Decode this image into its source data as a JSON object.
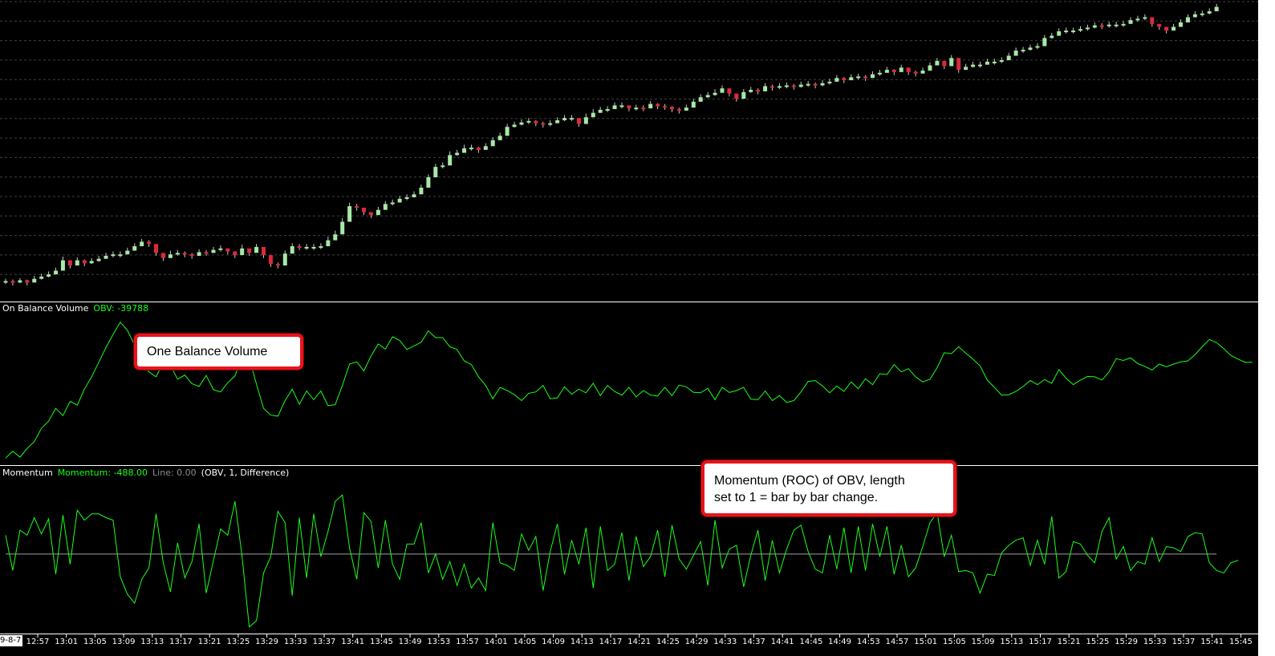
{
  "price_pane": {
    "colors": {
      "up": "#a8e8a6",
      "down": "#e0283a",
      "wick": "#c8c8c8",
      "grid": "#404040",
      "background": "#000000"
    }
  },
  "obv_pane": {
    "title": "On Balance Volume",
    "readout": "OBV: -39788",
    "line_color": "#19ff19"
  },
  "momentum_pane": {
    "title": "Momentum",
    "readout": "Momentum: -488.00",
    "zero_readout": "Line: 0.00",
    "params": "(OBV, 1, Difference)",
    "line_color": "#19ff19",
    "zero_line_color": "#a0a0a0"
  },
  "annotations": {
    "obv_callout": "One Balance Volume",
    "momentum_callout_line1": "Momentum (ROC) of OBV, length",
    "momentum_callout_line2": "set to 1 = bar by bar change."
  },
  "x_axis": {
    "date_label": "9-8-7",
    "ticks": [
      "12:57",
      "13:01",
      "13:05",
      "13:09",
      "13:13",
      "13:17",
      "13:21",
      "13:25",
      "13:29",
      "13:33",
      "13:37",
      "13:41",
      "13:45",
      "13:49",
      "13:53",
      "13:57",
      "14:01",
      "14:05",
      "14:09",
      "14:13",
      "14:17",
      "14:21",
      "14:25",
      "14:29",
      "14:33",
      "14:37",
      "14:41",
      "14:45",
      "14:49",
      "14:53",
      "14:57",
      "15:01",
      "15:05",
      "15:09",
      "15:13",
      "15:17",
      "15:21",
      "15:25",
      "15:29",
      "15:33",
      "15:37",
      "15:41",
      "15:45"
    ]
  },
  "chart_data": [
    {
      "type": "candlestick",
      "pane": "price",
      "title": "",
      "x": [
        "12:53",
        "12:54",
        "12:55",
        "12:56",
        "12:57",
        "12:58",
        "12:59",
        "13:00",
        "13:01",
        "13:02",
        "13:03",
        "13:04",
        "13:05",
        "13:06",
        "13:07",
        "13:08",
        "13:09",
        "13:10",
        "13:11",
        "13:12",
        "13:13",
        "13:14",
        "13:15",
        "13:16",
        "13:17",
        "13:18",
        "13:19",
        "13:20",
        "13:21",
        "13:22",
        "13:23",
        "13:24",
        "13:25",
        "13:26",
        "13:27",
        "13:28",
        "13:29",
        "13:30",
        "13:31",
        "13:32",
        "13:33",
        "13:34",
        "13:35",
        "13:36",
        "13:37",
        "13:38",
        "13:39",
        "13:40",
        "13:41",
        "13:42",
        "13:43",
        "13:44",
        "13:45",
        "13:46",
        "13:47",
        "13:48",
        "13:49",
        "13:50",
        "13:51",
        "13:52",
        "13:53",
        "13:54",
        "13:55",
        "13:56",
        "13:57",
        "13:58",
        "13:59",
        "14:00",
        "14:01",
        "14:02",
        "14:03",
        "14:04",
        "14:05",
        "14:06",
        "14:07",
        "14:08",
        "14:09",
        "14:10",
        "14:11",
        "14:12",
        "14:13",
        "14:14",
        "14:15",
        "14:16",
        "14:17",
        "14:18",
        "14:19",
        "14:20",
        "14:21",
        "14:22",
        "14:23",
        "14:24",
        "14:25",
        "14:26",
        "14:27",
        "14:28",
        "14:29",
        "14:30",
        "14:31",
        "14:32",
        "14:33",
        "14:34",
        "14:35",
        "14:36",
        "14:37",
        "14:38",
        "14:39",
        "14:40",
        "14:41",
        "14:42",
        "14:43",
        "14:44",
        "14:45",
        "14:46",
        "14:47",
        "14:48",
        "14:49",
        "14:50",
        "14:51",
        "14:52",
        "14:53",
        "14:54",
        "14:55",
        "14:56",
        "14:57",
        "14:58",
        "14:59",
        "15:00",
        "15:01",
        "15:02",
        "15:03",
        "15:04",
        "15:05",
        "15:06",
        "15:07",
        "15:08",
        "15:09",
        "15:10",
        "15:11",
        "15:12",
        "15:13",
        "15:14",
        "15:15",
        "15:16",
        "15:17",
        "15:18",
        "15:19",
        "15:20",
        "15:21",
        "15:22",
        "15:23",
        "15:24",
        "15:25",
        "15:26",
        "15:27",
        "15:28",
        "15:29",
        "15:30",
        "15:31",
        "15:32",
        "15:33",
        "15:34",
        "15:35",
        "15:36",
        "15:37",
        "15:38",
        "15:39",
        "15:40",
        "15:41"
      ],
      "close": [
        14,
        12,
        15,
        12,
        17,
        20,
        23,
        28,
        42,
        35,
        42,
        38,
        41,
        44,
        48,
        50,
        50,
        55,
        61,
        67,
        64,
        52,
        45,
        50,
        52,
        50,
        48,
        53,
        52,
        56,
        58,
        54,
        49,
        58,
        52,
        60,
        49,
        37,
        35,
        51,
        61,
        60,
        60,
        60,
        61,
        69,
        77,
        94,
        115,
        113,
        107,
        103,
        110,
        118,
        120,
        125,
        127,
        131,
        140,
        154,
        168,
        170,
        184,
        187,
        193,
        194,
        191,
        196,
        204,
        210,
        222,
        225,
        228,
        230,
        227,
        225,
        227,
        231,
        234,
        234,
        226,
        235,
        241,
        245,
        246,
        251,
        251,
        247,
        248,
        247,
        253,
        250,
        249,
        246,
        244,
        248,
        256,
        262,
        265,
        268,
        274,
        267,
        260,
        269,
        272,
        270,
        277,
        275,
        277,
        278,
        276,
        279,
        280,
        278,
        281,
        283,
        288,
        285,
        289,
        290,
        288,
        293,
        295,
        299,
        296,
        302,
        296,
        294,
        298,
        305,
        311,
        304,
        315,
        299,
        303,
        306,
        306,
        310,
        310,
        312,
        318,
        325,
        326,
        329,
        331,
        342,
        345,
        351,
        352,
        352,
        354,
        356,
        359,
        358,
        360,
        360,
        361,
        366,
        368,
        370,
        361,
        357,
        352,
        357,
        363,
        370,
        374,
        375,
        378,
        384
      ],
      "high": [
        17,
        16,
        18,
        16,
        21,
        24,
        27,
        32,
        47,
        40,
        46,
        43,
        45,
        48,
        52,
        54,
        54,
        59,
        65,
        71,
        69,
        56,
        50,
        55,
        56,
        54,
        52,
        57,
        56,
        60,
        62,
        58,
        53,
        63,
        57,
        64,
        54,
        41,
        39,
        55,
        65,
        64,
        64,
        64,
        65,
        74,
        82,
        99,
        120,
        118,
        111,
        107,
        114,
        122,
        124,
        129,
        131,
        135,
        144,
        158,
        172,
        174,
        189,
        191,
        198,
        198,
        195,
        200,
        208,
        214,
        226,
        229,
        232,
        234,
        231,
        229,
        231,
        235,
        238,
        238,
        230,
        240,
        246,
        249,
        250,
        255,
        255,
        251,
        252,
        251,
        257,
        254,
        253,
        250,
        248,
        252,
        260,
        266,
        269,
        273,
        278,
        271,
        264,
        273,
        276,
        274,
        281,
        279,
        281,
        282,
        280,
        283,
        284,
        282,
        285,
        287,
        292,
        289,
        293,
        294,
        292,
        297,
        299,
        303,
        300,
        306,
        300,
        298,
        302,
        309,
        315,
        308,
        319,
        303,
        307,
        310,
        310,
        314,
        314,
        316,
        322,
        329,
        330,
        333,
        335,
        346,
        349,
        355,
        356,
        356,
        358,
        360,
        363,
        362,
        364,
        364,
        365,
        370,
        372,
        374,
        365,
        361,
        356,
        361,
        367,
        374,
        378,
        379,
        382,
        388
      ],
      "low": [
        10,
        8,
        11,
        8,
        13,
        16,
        19,
        24,
        38,
        31,
        38,
        34,
        37,
        40,
        44,
        46,
        46,
        51,
        57,
        63,
        60,
        48,
        41,
        46,
        48,
        46,
        44,
        49,
        48,
        52,
        54,
        50,
        45,
        54,
        48,
        56,
        45,
        33,
        31,
        47,
        57,
        56,
        56,
        56,
        57,
        65,
        73,
        90,
        111,
        109,
        103,
        99,
        106,
        114,
        116,
        121,
        123,
        127,
        136,
        150,
        164,
        166,
        180,
        183,
        189,
        190,
        187,
        192,
        200,
        206,
        218,
        221,
        224,
        226,
        223,
        221,
        223,
        227,
        230,
        230,
        222,
        231,
        237,
        241,
        242,
        247,
        247,
        243,
        244,
        243,
        249,
        246,
        245,
        242,
        240,
        244,
        252,
        258,
        261,
        264,
        270,
        263,
        256,
        265,
        268,
        266,
        273,
        271,
        273,
        274,
        272,
        275,
        276,
        274,
        277,
        279,
        284,
        281,
        285,
        286,
        284,
        289,
        291,
        295,
        292,
        298,
        292,
        290,
        294,
        301,
        307,
        300,
        311,
        295,
        299,
        302,
        302,
        306,
        306,
        308,
        314,
        321,
        322,
        325,
        327,
        338,
        341,
        347,
        348,
        348,
        350,
        352,
        355,
        354,
        356,
        356,
        357,
        362,
        364,
        366,
        357,
        353,
        348,
        353,
        359,
        366,
        370,
        371,
        374,
        380
      ]
    },
    {
      "type": "line",
      "pane": "obv",
      "title": "On Balance Volume",
      "series": [
        {
          "name": "OBV",
          "values": [
            -39788
          ]
        }
      ],
      "values": [
        -60800,
        -59300,
        -60600,
        -58700,
        -57200,
        -54300,
        -52700,
        -49900,
        -51500,
        -48400,
        -49200,
        -45700,
        -43000,
        -39800,
        -36600,
        -33700,
        -31000,
        -32800,
        -36000,
        -39900,
        -41900,
        -43000,
        -39800,
        -40500,
        -43500,
        -42600,
        -44500,
        -45100,
        -42700,
        -45800,
        -46300,
        -44300,
        -42800,
        -38600,
        -38800,
        -44600,
        -49900,
        -51400,
        -51600,
        -48200,
        -45700,
        -49000,
        -46100,
        -48000,
        -46100,
        -49300,
        -49100,
        -44900,
        -40200,
        -39700,
        -41700,
        -38400,
        -35800,
        -36900,
        -34200,
        -35000,
        -37000,
        -36200,
        -35400,
        -32900,
        -34400,
        -34400,
        -36400,
        -37000,
        -39500,
        -40300,
        -43000,
        -44900,
        -47800,
        -45300,
        -46000,
        -46900,
        -48200,
        -46600,
        -46300,
        -44900,
        -47800,
        -47600,
        -45200,
        -46800,
        -45700,
        -46500,
        -44400,
        -47100,
        -44900,
        -46200,
        -47000,
        -45300,
        -47400,
        -46000,
        -47000,
        -47200,
        -45300,
        -47100,
        -44800,
        -45200,
        -46400,
        -46500,
        -45500,
        -48000,
        -45300,
        -46400,
        -46000,
        -45300,
        -47900,
        -48000,
        -46100,
        -48200,
        -47100,
        -48600,
        -48200,
        -46300,
        -44000,
        -43800,
        -45000,
        -46500,
        -45000,
        -46200,
        -44100,
        -45600,
        -43400,
        -44700,
        -42300,
        -42500,
        -40300,
        -41900,
        -41200,
        -43000,
        -44100,
        -43500,
        -41000,
        -37700,
        -37900,
        -36400,
        -37800,
        -39100,
        -40600,
        -43700,
        -45300,
        -47000,
        -46900,
        -46200,
        -45100,
        -43800,
        -44700,
        -43600,
        -44400,
        -41400,
        -43300,
        -44700,
        -43700,
        -42900,
        -43000,
        -43700,
        -41900,
        -39000,
        -39400,
        -38800,
        -40100,
        -40700,
        -41500,
        -40200,
        -40800,
        -40200,
        -39700,
        -39500,
        -38100,
        -36400,
        -34800,
        -35500,
        -36800,
        -38300,
        -39100,
        -39800,
        -39788
      ],
      "ylim": [
        -62000,
        -30000
      ]
    },
    {
      "type": "line",
      "pane": "momentum",
      "title": "Momentum",
      "series": [
        {
          "name": "Momentum",
          "values": [
            -488.0
          ]
        },
        {
          "name": "Line",
          "values": [
            0.0
          ]
        }
      ],
      "values": [
        1500,
        -1300,
        1900,
        1500,
        2900,
        1600,
        2800,
        -1600,
        3100,
        -800,
        3500,
        2700,
        3200,
        3200,
        2900,
        2700,
        -1800,
        -3200,
        -3900,
        -2000,
        -1100,
        3200,
        -700,
        -3000,
        900,
        -1900,
        -600,
        2400,
        -3100,
        -500,
        2000,
        1500,
        4200,
        -200,
        -5800,
        -5300,
        -1500,
        -200,
        3400,
        2500,
        -3300,
        2900,
        -1900,
        3200,
        -200,
        1800,
        4200,
        4700,
        500,
        -2000,
        3300,
        2600,
        -1100,
        2700,
        -800,
        -2000,
        800,
        800,
        2500,
        -1500,
        0,
        -2000,
        -600,
        -2500,
        -800,
        -2700,
        -1900,
        -2900,
        2500,
        -700,
        -900,
        -1300,
        1600,
        300,
        1400,
        -2900,
        200,
        2400,
        -1600,
        1100,
        -800,
        2100,
        -2700,
        2200,
        -1300,
        -800,
        1700,
        -2100,
        1400,
        -1000,
        -200,
        1900,
        -1800,
        2300,
        -400,
        -1200,
        -100,
        1000,
        -2500,
        2700,
        -1100,
        400,
        700,
        -2600,
        -100,
        1900,
        -2100,
        1100,
        -1500,
        400,
        1900,
        2300,
        200,
        -1200,
        -1500,
        1500,
        -1200,
        2100,
        -1500,
        2200,
        -1300,
        2400,
        -200,
        2200,
        -1600,
        700,
        -1800,
        -1100,
        600,
        2500,
        3300,
        -200,
        1500,
        -1400,
        -1300,
        -1500,
        -3100,
        -1600,
        -1700,
        100,
        700,
        1100,
        1300,
        -900,
        1100,
        -800,
        3000,
        -1900,
        -1400,
        1000,
        800,
        -100,
        -700,
        1800,
        2900,
        -400,
        600,
        -1300,
        -600,
        -800,
        1300,
        -600,
        600,
        500,
        200,
        1400,
        1700,
        1600,
        -700,
        -1300,
        -1500,
        -700,
        -488
      ],
      "zero_line": 0,
      "ylim": [
        -6000,
        5800
      ]
    }
  ]
}
